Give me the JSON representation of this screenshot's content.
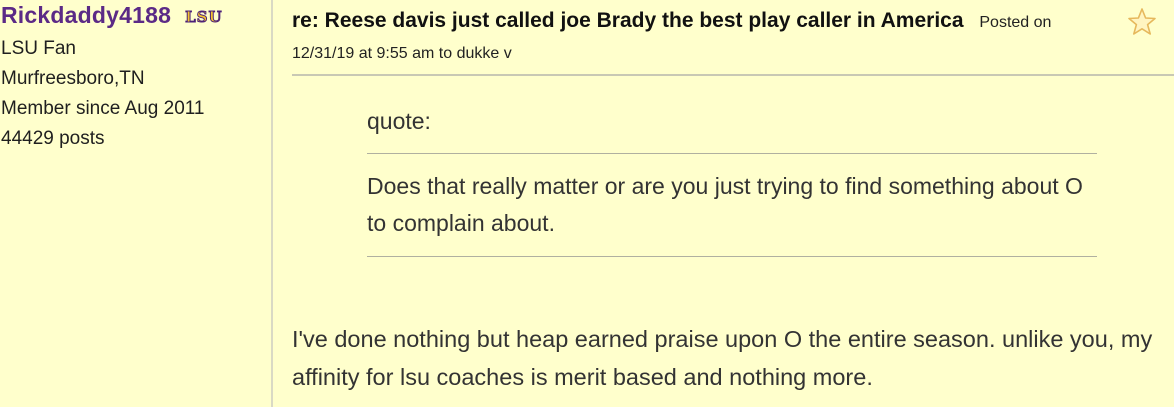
{
  "author": {
    "username": "Rickdaddy4188",
    "team_logo_text": "LSU",
    "fan_of": "LSU Fan",
    "location": "Murfreesboro,TN",
    "member_since": "Member since Aug 2011",
    "post_count": "44429 posts"
  },
  "post": {
    "title": "re: Reese davis just called joe Brady the best play caller in America",
    "meta": "Posted on 12/31/19 at 9:55 am to dukke v",
    "quote_label": "quote:",
    "quote_text": "Does that really matter or are you just trying to find something about O to complain about.",
    "reply_text": "I've done nothing but heap earned praise upon O the entire season. unlike you, my affinity for lsu coaches is merit based and nothing more."
  },
  "icons": {
    "favorite": "star-icon"
  },
  "colors": {
    "background": "#ffffcc",
    "username": "#5b2a86",
    "logo_gold": "#f4c430"
  }
}
